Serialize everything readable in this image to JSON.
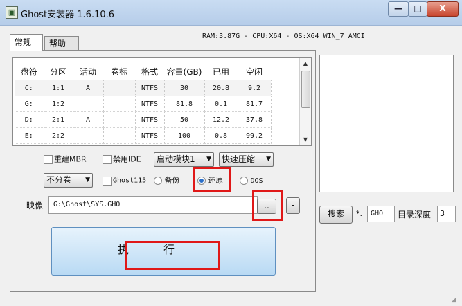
{
  "window": {
    "title": "Ghost安装器 1.6.10.6",
    "minimize_glyph": "—",
    "maximize_glyph": "□",
    "close_glyph": "X"
  },
  "sysinfo": "RAM:3.87G - CPU:X64 - OS:X64 WIN_7 AMCI",
  "tabs": [
    {
      "label": "常规",
      "active": true
    },
    {
      "label": "帮助",
      "active": false
    }
  ],
  "partition_table": {
    "columns": [
      "盘符",
      "分区",
      "活动",
      "卷标",
      "格式",
      "容量(GB)",
      "已用",
      "空闲"
    ],
    "rows": [
      [
        "C:",
        "1:1",
        "A",
        "",
        "NTFS",
        "30",
        "20.8",
        "9.2"
      ],
      [
        "G:",
        "1:2",
        "",
        "",
        "NTFS",
        "81.8",
        "0.1",
        "81.7"
      ],
      [
        "D:",
        "2:1",
        "A",
        "",
        "NTFS",
        "50",
        "12.2",
        "37.8"
      ],
      [
        "E:",
        "2:2",
        "",
        "",
        "NTFS",
        "100",
        "0.8",
        "99.2"
      ]
    ]
  },
  "options": {
    "rebuild_mbr": {
      "label": "重建MBR",
      "checked": false
    },
    "disable_ide": {
      "label": "禁用IDE",
      "checked": false
    },
    "boot_module": {
      "value": "启动模块1"
    },
    "compression": {
      "value": "快速压缩"
    },
    "split": {
      "value": "不分卷"
    },
    "ghost115": {
      "label": "Ghost115",
      "checked": false
    },
    "mode_backup": {
      "label": "备份",
      "selected": false
    },
    "mode_restore": {
      "label": "还原",
      "selected": true
    },
    "mode_dos": {
      "label": "DOS",
      "selected": false
    }
  },
  "image": {
    "label": "映像",
    "path": "G:\\Ghost\\SYS.GHO",
    "browse_label": "..",
    "minus_label": "-"
  },
  "execute_label": "执行",
  "search": {
    "button_label": "搜索",
    "ext_prefix": "*.",
    "ext_value": "GHO",
    "depth_label": "目录深度",
    "depth_value": "3"
  },
  "colors": {
    "highlight": "#e01818",
    "execute_bg": "#b9daf4"
  }
}
